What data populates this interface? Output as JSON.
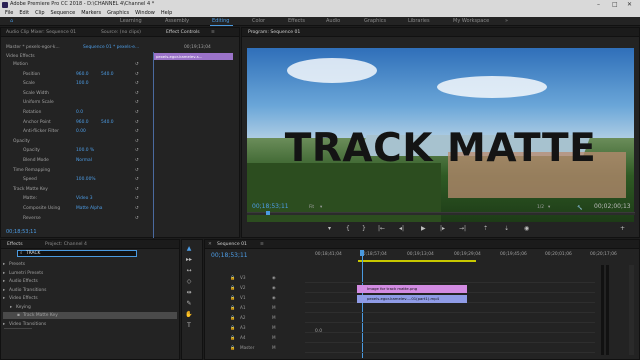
{
  "window": {
    "title": "Adobe Premiere Pro CC 2018 - D:\\CHANNEL 4\\Channel 4 *",
    "controls": [
      "–",
      "□",
      "✕"
    ]
  },
  "menu": [
    "File",
    "Edit",
    "Clip",
    "Sequence",
    "Markers",
    "Graphics",
    "Window",
    "Help"
  ],
  "workspaces": [
    "Learning",
    "Assembly",
    "Editing",
    "Color",
    "Effects",
    "Audio",
    "Graphics",
    "Libraries",
    "My Workspace"
  ],
  "active_workspace": "Editing",
  "source_panel": {
    "tabs": [
      "Audio Clip Mixer: Sequence 01",
      "Source: (no clips)",
      "Effect Controls",
      "≡"
    ],
    "master_label": "Master * pexels-egor-k...",
    "sequence_label": "Sequence 01 * pexels-e...",
    "ruler_time": "00;19;13;04",
    "clip_label": "pexels-egor-kamelev-s...",
    "video_effects_header": "Video Effects",
    "rows": [
      {
        "name": "Motion",
        "value": "",
        "value2": ""
      },
      {
        "name": "Position",
        "value": "960.0",
        "value2": "540.0"
      },
      {
        "name": "Scale",
        "value": "100.0",
        "value2": ""
      },
      {
        "name": "Scale Width",
        "value": "",
        "value2": ""
      },
      {
        "name": "Uniform Scale",
        "value": "",
        "value2": ""
      },
      {
        "name": "Rotation",
        "value": "0.0",
        "value2": ""
      },
      {
        "name": "Anchor Point",
        "value": "960.0",
        "value2": "540.0"
      },
      {
        "name": "Anti-flicker Filter",
        "value": "0.00",
        "value2": ""
      },
      {
        "name": "Opacity",
        "value": "",
        "value2": ""
      },
      {
        "name": "Opacity",
        "value": "100.0 %",
        "value2": ""
      },
      {
        "name": "Blend Mode",
        "value": "Normal",
        "value2": ""
      },
      {
        "name": "Time Remapping",
        "value": "",
        "value2": ""
      },
      {
        "name": "Speed",
        "value": "100.00%",
        "value2": ""
      },
      {
        "name": "Track Matte Key",
        "value": "",
        "value2": ""
      },
      {
        "name": "Matte:",
        "value": "Video 3",
        "value2": ""
      },
      {
        "name": "Composite Using",
        "value": "Matte Alpha",
        "value2": ""
      },
      {
        "name": "Reverse",
        "value": "",
        "value2": ""
      }
    ],
    "footer_time": "00;18;53;11"
  },
  "program": {
    "title": "Program: Sequence 01",
    "overlay_text": "TRACK MATTE",
    "timecode": "00;18;53;11",
    "fit": "Fit",
    "resolution": "1/2",
    "duration": "00;02;00;13"
  },
  "effects_panel": {
    "tabs": [
      "Effects",
      "Project: Channel 4"
    ],
    "search_value": "TRACK",
    "items": [
      {
        "label": "Presets",
        "indent": 0
      },
      {
        "label": "Lumetri Presets",
        "indent": 0
      },
      {
        "label": "Audio Effects",
        "indent": 0
      },
      {
        "label": "Audio Transitions",
        "indent": 0
      },
      {
        "label": "Video Effects",
        "indent": 0
      },
      {
        "label": "Keying",
        "indent": 1
      },
      {
        "label": "Track Matte Key",
        "indent": 2
      },
      {
        "label": "Video Transitions",
        "indent": 0
      }
    ]
  },
  "timeline": {
    "tab": "Sequence 01",
    "timecode": "00;18;53;11",
    "ruler_labels": [
      "00;18;41;04",
      "00;18;57;04",
      "00;19;13;04",
      "00;19;29;04",
      "00;19;45;06",
      "00;20;01;06",
      "00;20;17;06"
    ],
    "tracks": [
      "V3",
      "V2",
      "V1",
      "A1",
      "A2",
      "A3",
      "A4",
      "Master"
    ],
    "clips": [
      {
        "label": "Image for track matte.png",
        "track": "V3"
      },
      {
        "label": "pexels-egor-kamelev-...01(part1).mp4",
        "track": "V2"
      }
    ],
    "master_value": "0.0"
  },
  "colors": {
    "accent": "#4a9ae0",
    "clip_pink": "#d28be2",
    "clip_blue": "#8f9be6",
    "title_bg": "#d9d9d9"
  }
}
